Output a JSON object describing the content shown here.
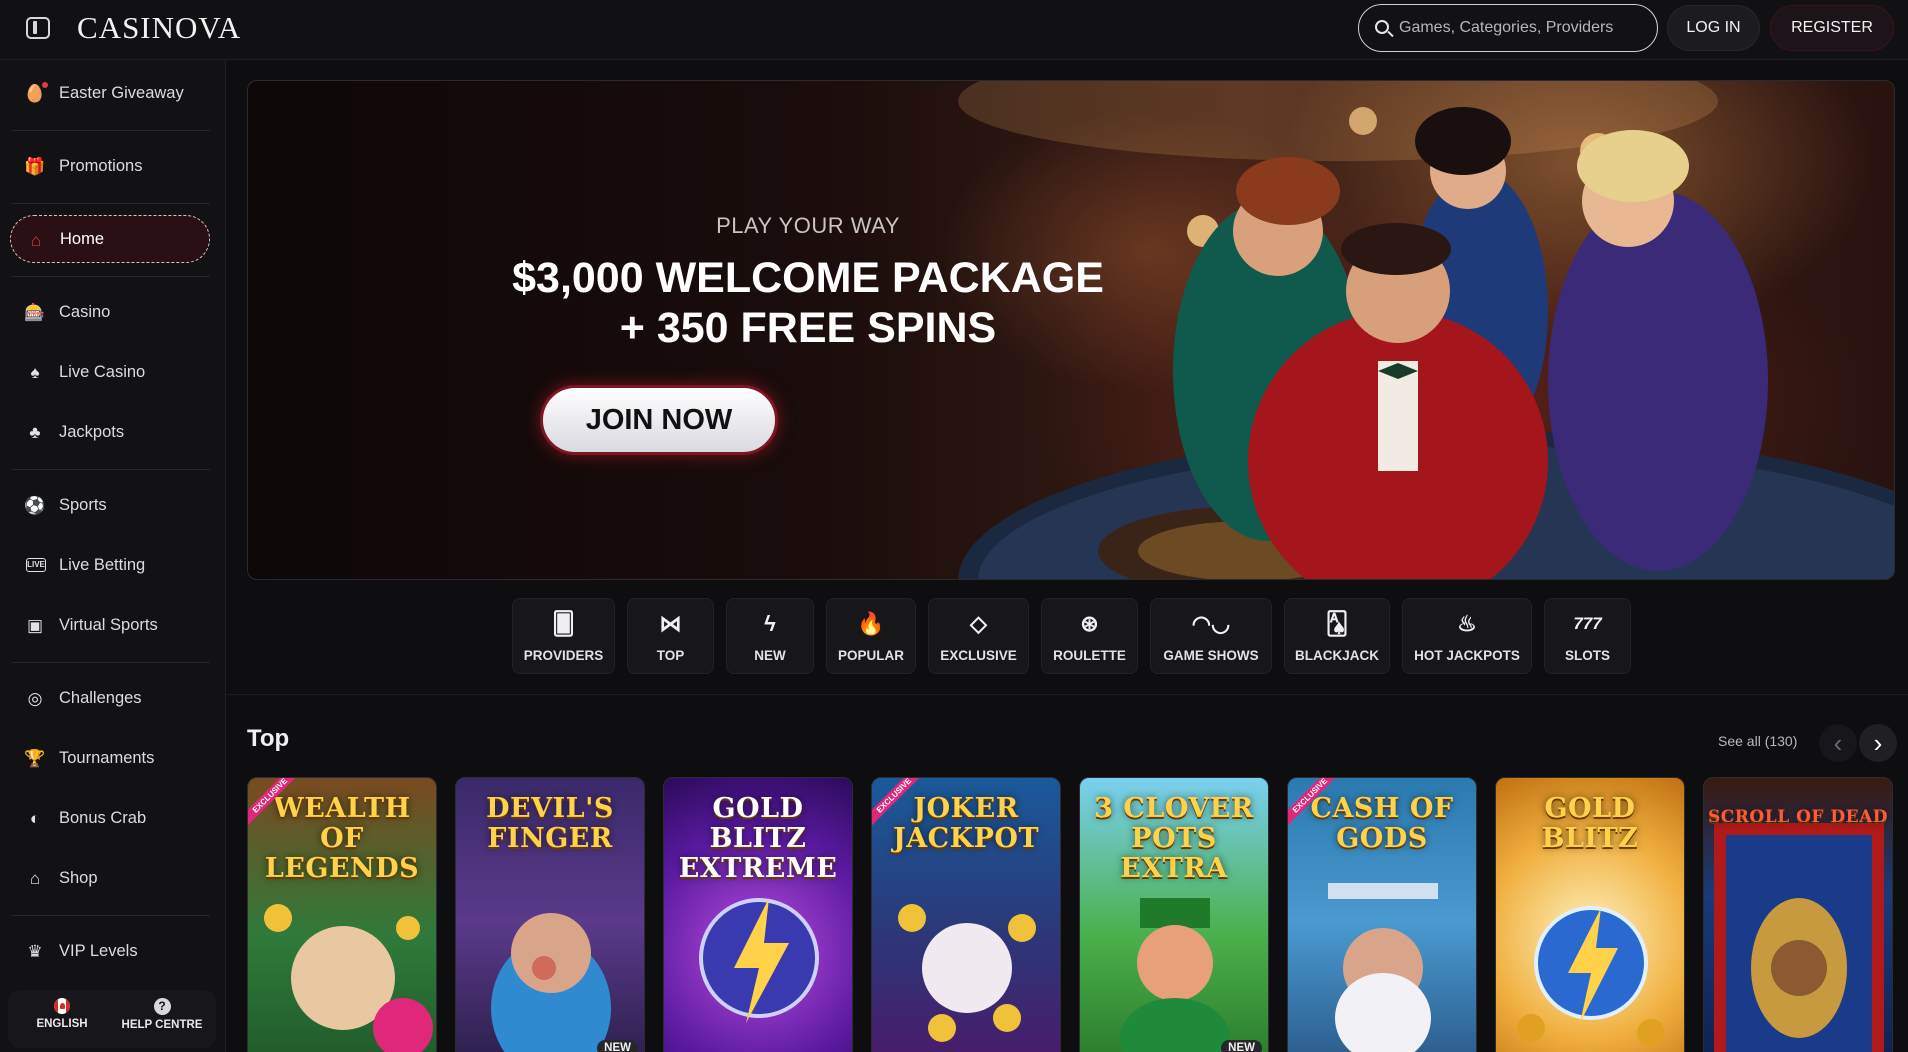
{
  "header": {
    "logo": "CASINOVA",
    "search_placeholder": "Games, Categories, Providers",
    "login_label": "LOG IN",
    "register_label": "REGISTER"
  },
  "sidebar": {
    "items": [
      {
        "label": "Easter Giveaway",
        "icon": "easter-egg-icon"
      },
      {
        "label": "Promotions",
        "icon": "gift-icon"
      },
      {
        "label": "Home",
        "icon": "home-icon",
        "active": true
      },
      {
        "label": "Casino",
        "icon": "slot-machine-icon"
      },
      {
        "label": "Live Casino",
        "icon": "live-dealer-icon"
      },
      {
        "label": "Jackpots",
        "icon": "clover-icon"
      },
      {
        "label": "Sports",
        "icon": "soccer-ball-icon"
      },
      {
        "label": "Live Betting",
        "icon": "live-tv-icon"
      },
      {
        "label": "Virtual Sports",
        "icon": "virtual-sports-icon"
      },
      {
        "label": "Challenges",
        "icon": "target-icon"
      },
      {
        "label": "Tournaments",
        "icon": "trophy-icon"
      },
      {
        "label": "Bonus Crab",
        "icon": "crab-claw-icon"
      },
      {
        "label": "Shop",
        "icon": "shop-icon"
      },
      {
        "label": "VIP Levels",
        "icon": "crown-icon"
      }
    ],
    "footer": {
      "language_label": "ENGLISH",
      "help_label": "HELP CENTRE"
    }
  },
  "hero": {
    "kicker": "PLAY YOUR WAY",
    "title_line1": "$3,000 WELCOME PACKAGE",
    "title_line2": "+ 350 FREE SPINS",
    "cta_label": "JOIN NOW"
  },
  "categories": [
    {
      "label": "PROVIDERS",
      "icon": "cards-icon"
    },
    {
      "label": "TOP",
      "icon": "bow-tie-icon"
    },
    {
      "label": "NEW",
      "icon": "lightning-icon"
    },
    {
      "label": "POPULAR",
      "icon": "flame-icon"
    },
    {
      "label": "EXCLUSIVE",
      "icon": "diamond-icon"
    },
    {
      "label": "ROULETTE",
      "icon": "roulette-icon"
    },
    {
      "label": "GAME SHOWS",
      "icon": "mask-icon"
    },
    {
      "label": "BLACKJACK",
      "icon": "playing-cards-icon"
    },
    {
      "label": "HOT JACKPOTS",
      "icon": "hot-jackpot-icon"
    },
    {
      "label": "SLOTS",
      "icon": "777-icon"
    }
  ],
  "section": {
    "title": "Top",
    "see_all": "See all (130)"
  },
  "games": [
    {
      "title": "WEALTH OF LEGENDS",
      "badge": "EXCLUSIVE",
      "flag": ""
    },
    {
      "title": "DEVIL'S FINGER",
      "badge": "",
      "flag": "NEW"
    },
    {
      "title": "GOLD BLITZ EXTREME",
      "badge": "",
      "flag": ""
    },
    {
      "title": "JOKER JACKPOT",
      "badge": "EXCLUSIVE",
      "flag": ""
    },
    {
      "title": "3 CLOVER POTS EXTRA",
      "badge": "",
      "flag": "NEW"
    },
    {
      "title": "CASH OF GODS",
      "badge": "EXCLUSIVE",
      "flag": ""
    },
    {
      "title": "GOLD BLITZ",
      "badge": "",
      "flag": ""
    },
    {
      "title": "SCROLL OF DEAD",
      "badge": "",
      "flag": ""
    }
  ],
  "colors": {
    "accent_red": "#e23b3b",
    "background": "#0e0e10",
    "panel": "#121215"
  }
}
